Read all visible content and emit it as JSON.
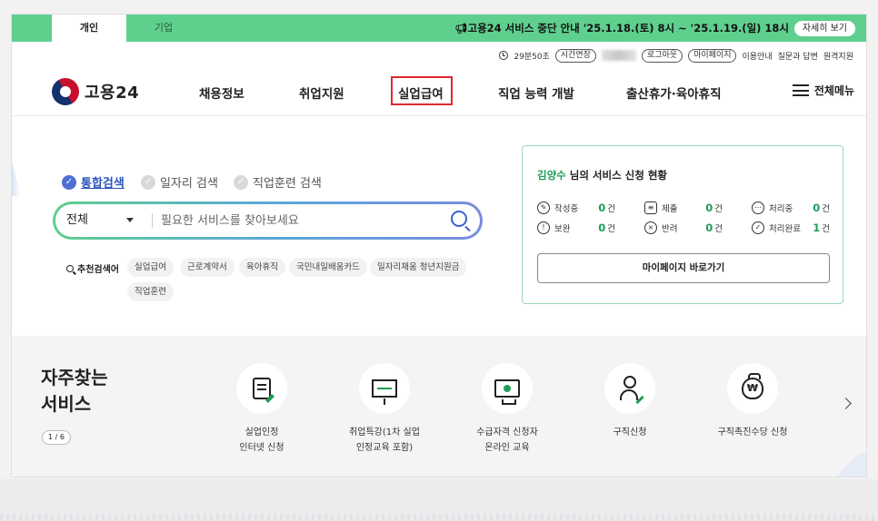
{
  "top_tabs": {
    "personal": "개인",
    "business": "기업"
  },
  "notice": {
    "text": "고용24 서비스 중단 안내 '25.1.18.(토) 8시 ~ '25.1.19.(일) 18시",
    "button": "자세히 보기"
  },
  "util": {
    "timer": "29분50초",
    "extend": "시간연장",
    "logout": "로그아웃",
    "mypage": "마이페이지",
    "guide": "이용안내",
    "qna": "질문과 답변",
    "remote": "원격지원"
  },
  "header": {
    "logo": "고용24",
    "nav": [
      "채용정보",
      "취업지원",
      "실업급여",
      "직업 능력 개발",
      "출산휴가·육아휴직"
    ],
    "all_menu": "전체메뉴"
  },
  "search": {
    "tabs": [
      "통합검색",
      "일자리 검색",
      "직업훈련 검색"
    ],
    "select_value": "전체",
    "placeholder": "필요한 서비스를 찾아보세요",
    "recommend_label": "추천검색어",
    "keywords": [
      "실업급여",
      "근로계약서",
      "육아휴직",
      "국민내일배움카드",
      "일자리채움 청년지원금",
      "직업훈련"
    ]
  },
  "status_card": {
    "user": "김양수",
    "title_suffix": " 님의 서비스 신청 현황",
    "items": [
      {
        "label": "작성중",
        "count": "0",
        "unit": "건"
      },
      {
        "label": "제출",
        "count": "0",
        "unit": "건"
      },
      {
        "label": "처리중",
        "count": "0",
        "unit": "건"
      },
      {
        "label": "보완",
        "count": "0",
        "unit": "건"
      },
      {
        "label": "반려",
        "count": "0",
        "unit": "건"
      },
      {
        "label": "처리완료",
        "count": "1",
        "unit": "건"
      }
    ],
    "button": "마이페이지 바로가기"
  },
  "frequent": {
    "title_line1": "자주찾는",
    "title_line2": "서비스",
    "pager": "1 / 6",
    "services": [
      {
        "line1": "실업인정",
        "line2": "인터넷 신청",
        "icon": "document-pen-icon"
      },
      {
        "line1": "취업특강(1차 실업",
        "line2": "인정교육 포함)",
        "icon": "presentation-board-icon"
      },
      {
        "line1": "수급자격 신청자",
        "line2": "온라인 교육",
        "icon": "monitor-play-icon"
      },
      {
        "line1": "구직신청",
        "line2": "",
        "icon": "person-pen-icon"
      },
      {
        "line1": "구직촉진수당 신청",
        "line2": "",
        "icon": "money-bag-icon"
      }
    ]
  },
  "colors": {
    "brand_green": "#5fcf8e",
    "accent_green": "#1e9d57",
    "highlight_red": "#e0282e",
    "link_blue": "#2c55c2"
  }
}
